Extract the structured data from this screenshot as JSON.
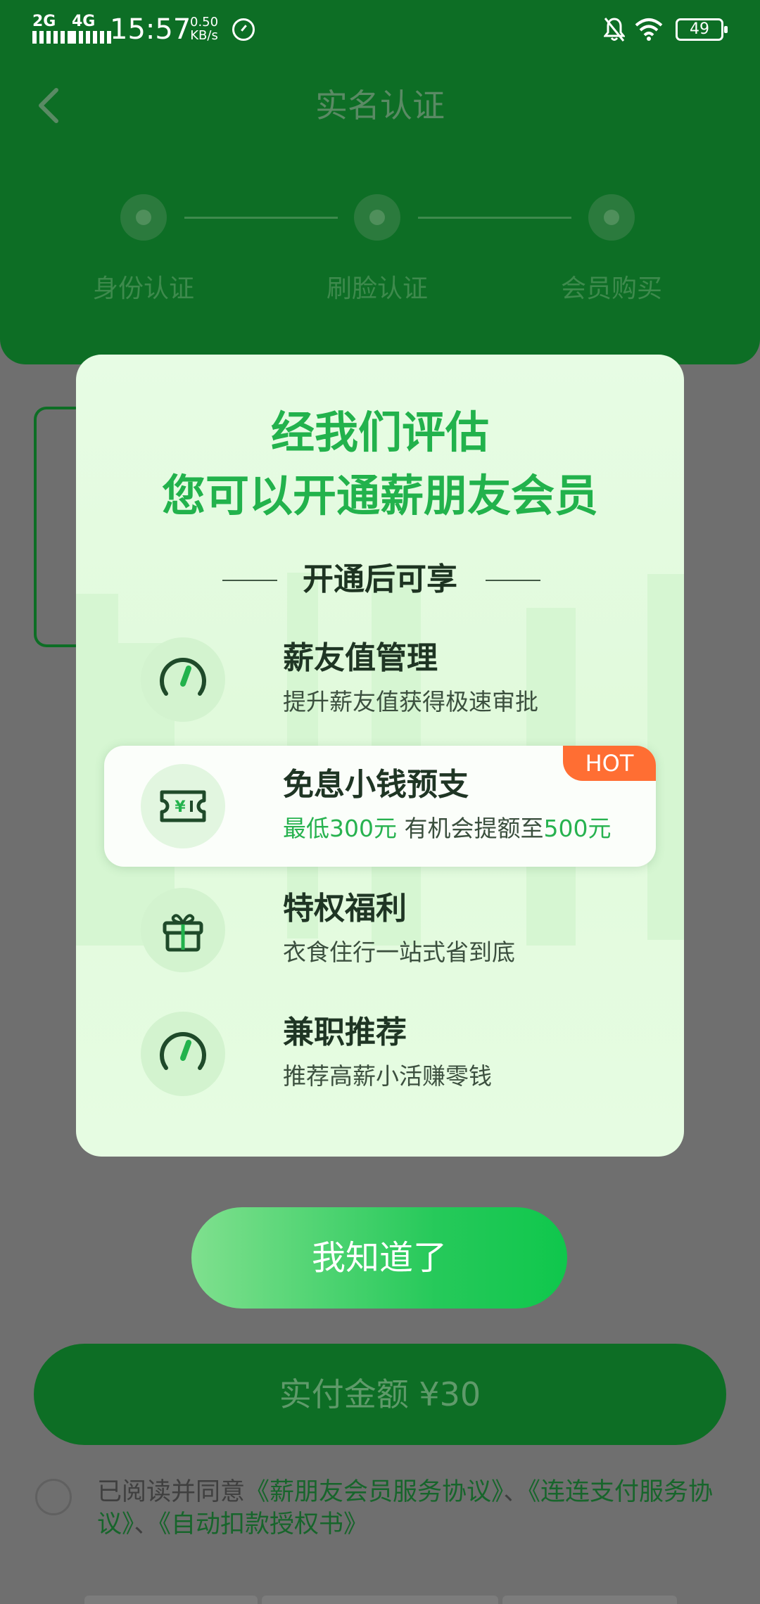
{
  "status_bar": {
    "signal1": "2G",
    "signal2": "4G",
    "time": "15:57",
    "speed_value": "0.50",
    "speed_unit": "KB/s",
    "battery": "49"
  },
  "header": {
    "title": "实名认证",
    "steps": [
      "身份认证",
      "刷脸认证",
      "会员购买"
    ]
  },
  "modal": {
    "title_line1": "经我们评估",
    "title_line2": "您可以开通薪朋友会员",
    "subheading": "开通后可享",
    "benefits": [
      {
        "title": "薪友值管理",
        "desc": "提升薪友值获得极速审批",
        "icon": "speedometer-icon"
      },
      {
        "title": "免息小钱预支",
        "desc_part1": "最低300元",
        "desc_part2": " 有机会提额至",
        "desc_part3": "500元",
        "badge": "HOT",
        "icon": "ticket-icon"
      },
      {
        "title": "特权福利",
        "desc": "衣食住行一站式省到底",
        "icon": "gift-icon"
      },
      {
        "title": "兼职推荐",
        "desc": "推荐高薪小活赚零钱",
        "icon": "speedometer-icon"
      }
    ],
    "confirm_label": "我知道了"
  },
  "page": {
    "pay_label": "实付金额 ¥30",
    "agreement_prefix": "已阅读并同意",
    "agreement_link1": "《薪朋友会员服务协议》",
    "agreement_sep": "、",
    "agreement_link2": "《连连支付服务协议》",
    "agreement_link3": "《自动扣款授权书》"
  },
  "colors": {
    "brand_green": "#22b24c",
    "header_green_dimmed": "#0d6e25",
    "hot_badge": "#ff6e33"
  }
}
